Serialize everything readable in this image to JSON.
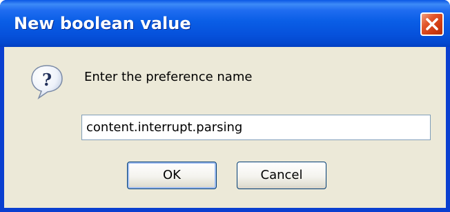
{
  "window": {
    "title": "New boolean value",
    "close_icon": "close-x-icon"
  },
  "dialog": {
    "icon": "question-icon",
    "prompt": "Enter the preference name",
    "input_value": "content.interrupt.parsing",
    "ok_label": "OK",
    "cancel_label": "Cancel"
  },
  "colors": {
    "titlebar": "#0a5ee6",
    "dialog_bg": "#ece9d8",
    "close_button": "#e2562b"
  }
}
